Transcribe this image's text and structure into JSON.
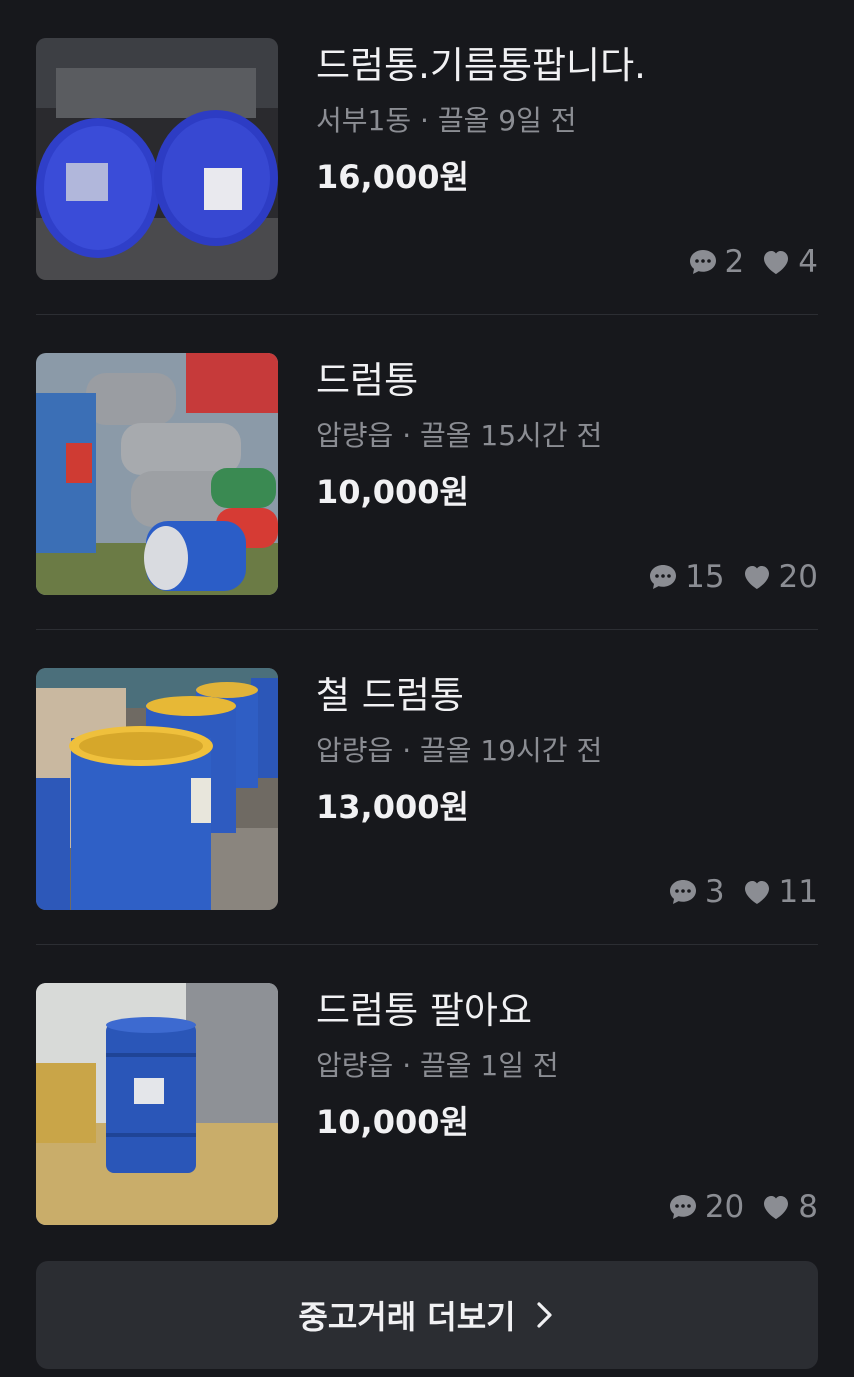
{
  "listings": [
    {
      "title": "드럼통.기름통팝니다.",
      "location": "서부1동",
      "separator": "·",
      "time": "끌올 9일 전",
      "price": "16,000원",
      "comments": "2",
      "likes": "4",
      "comment_icon": "chat-bubble-icon",
      "like_icon": "heart-icon"
    },
    {
      "title": "드럼통",
      "location": "압량읍",
      "separator": "·",
      "time": "끌올 15시간 전",
      "price": "10,000원",
      "comments": "15",
      "likes": "20",
      "comment_icon": "chat-bubble-icon",
      "like_icon": "heart-icon"
    },
    {
      "title": "철 드럼통",
      "location": "압량읍",
      "separator": "·",
      "time": "끌올 19시간 전",
      "price": "13,000원",
      "comments": "3",
      "likes": "11",
      "comment_icon": "chat-bubble-icon",
      "like_icon": "heart-icon"
    },
    {
      "title": "드럼통 팔아요",
      "location": "압량읍",
      "separator": "·",
      "time": "끌올 1일 전",
      "price": "10,000원",
      "comments": "20",
      "likes": "8",
      "comment_icon": "chat-bubble-icon",
      "like_icon": "heart-icon"
    }
  ],
  "more_button": {
    "label": "중고거래 더보기",
    "icon": "chevron-right-icon"
  },
  "colors": {
    "background": "#17181c",
    "text_primary": "#f1f1f3",
    "text_secondary": "#8b8d93",
    "divider": "#2c2e33",
    "button_bg": "#2b2d32"
  }
}
